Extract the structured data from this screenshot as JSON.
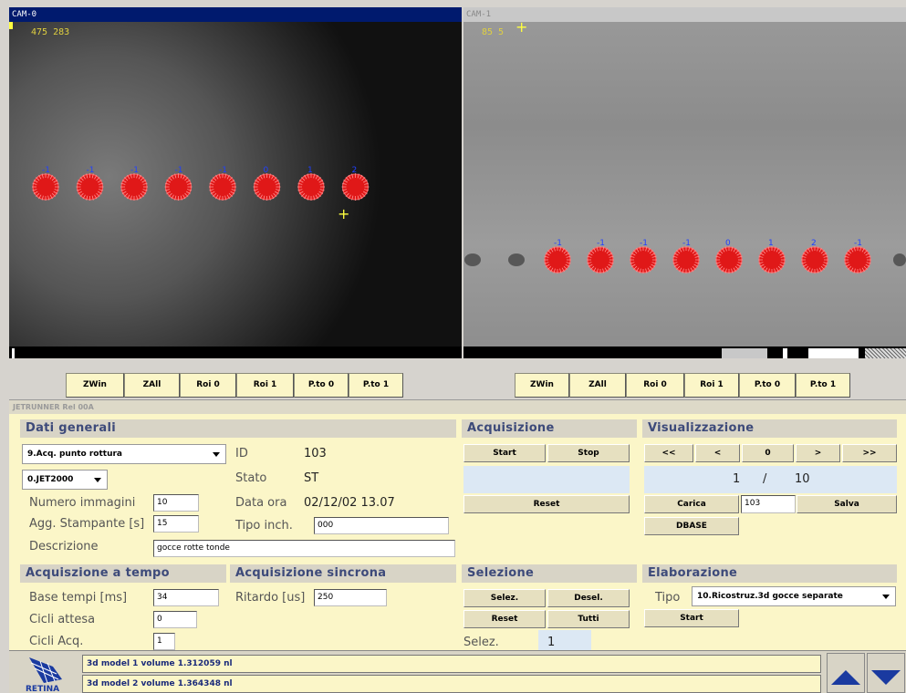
{
  "cam0": {
    "title": "CAM-0",
    "coord": "475 283"
  },
  "cam1": {
    "title": "CAM-1",
    "coord": "85 5"
  },
  "cam0_dots": {
    "labels": [
      "-1",
      "-1",
      "-1",
      "-1",
      "-1",
      "0",
      "1",
      "2"
    ]
  },
  "cam1_dots": {
    "labels": [
      "-1",
      "-1",
      "-1",
      "-1",
      "0",
      "1",
      "2",
      "-1"
    ]
  },
  "toolbar_left": [
    "ZWin",
    "ZAll",
    "Roi 0",
    "Roi 1",
    "P.to 0",
    "P.to 1"
  ],
  "toolbar_right": [
    "ZWin",
    "ZAll",
    "Roi 0",
    "Roi 1",
    "P.to 0",
    "P.to 1"
  ],
  "panel": {
    "title": "JETRUNNER Rel 00A",
    "dati_generali": {
      "header": "Dati generali",
      "mode_select": "9.Acq. punto rottura",
      "jet_select": "0.JET2000",
      "numero_immagini_label": "Numero immagini",
      "numero_immagini": "10",
      "agg_stampante_label": "Agg. Stampante [s]",
      "agg_stampante": "15",
      "descrizione_label": "Descrizione",
      "descrizione": "gocce rotte tonde",
      "id_label": "ID",
      "id_value": "103",
      "stato_label": "Stato",
      "stato_value": "ST",
      "data_ora_label": "Data ora",
      "data_ora_value": "02/12/02 13.07",
      "tipo_inch_label": "Tipo inch.",
      "tipo_inch_value": "000"
    },
    "acq_tempo": {
      "header": "Acquiszione a tempo",
      "base_tempi_label": "Base tempi [ms]",
      "base_tempi": "34",
      "cicli_attesa_label": "Cicli attesa",
      "cicli_attesa": "0",
      "cicli_acq_label": "Cicli Acq.",
      "cicli_acq": "1"
    },
    "acq_sincrona": {
      "header": "Acquisizione sincrona",
      "ritardo_label": "Ritardo [us]",
      "ritardo": "250"
    },
    "acquisizione": {
      "header": "Acquisizione",
      "start": "Start",
      "stop": "Stop",
      "reset": "Reset"
    },
    "selezione": {
      "header": "Selezione",
      "selez_btn": "Selez.",
      "desel_btn": "Desel.",
      "reset_btn": "Reset",
      "tutti_btn": "Tutti",
      "selez_label": "Selez.",
      "selez_value": "1"
    },
    "visualizzazione": {
      "header": "Visualizzazione",
      "nav": [
        "<<",
        "<",
        "0",
        ">",
        ">>"
      ],
      "current": "1",
      "sep": "/",
      "total": "10",
      "carica": "Carica",
      "carica_value": "103",
      "salva": "Salva",
      "dbase": "DBASE"
    },
    "elaborazione": {
      "header": "Elaborazione",
      "tipo_label": "Tipo",
      "tipo_select": "10.Ricostruz.3d gocce separate",
      "start": "Start"
    }
  },
  "footer": {
    "logo_text": "RETINA",
    "messages": [
      "3d model 1 volume 1.312059 nl",
      "3d model 2 volume 1.364348 nl"
    ]
  },
  "colors": {
    "drop_red": "#e01818",
    "panel_bg": "#fbf6c8",
    "header_text": "#3d4a7a",
    "cam_title_bar": "#001a6e"
  }
}
